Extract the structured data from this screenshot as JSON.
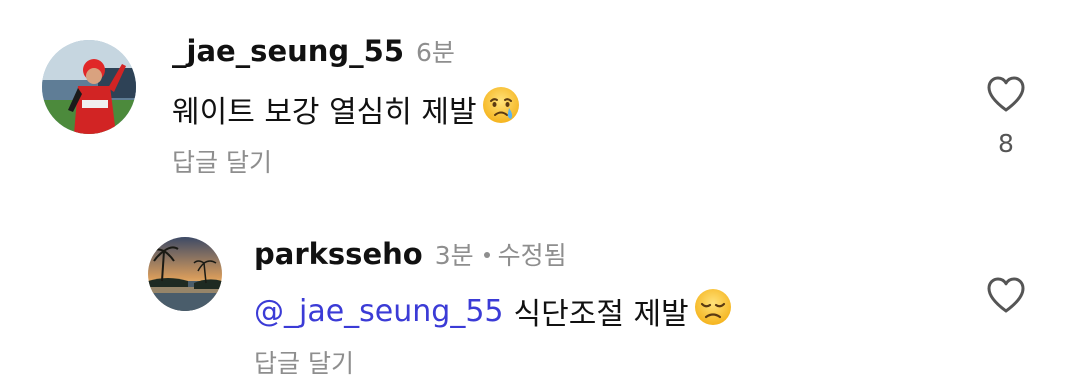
{
  "comments": [
    {
      "username": "_jae_seung_55",
      "time": "6분",
      "edited": "",
      "mention": "",
      "text": "웨이트 보강 열심히 제발",
      "emoji": "crying-face",
      "reply_label": "답글 달기",
      "like_count": "8",
      "avatar": "avatar-photo-baseball-player"
    },
    {
      "username": "parksseho",
      "time": "3분",
      "edited": "수정됨",
      "mention": "@_jae_seung_55",
      "text": "식단조절 제발",
      "emoji": "disappointed-face",
      "reply_label": "답글 달기",
      "like_count": "",
      "avatar": "avatar-photo-palm-sunset"
    }
  ],
  "colors": {
    "mention": "#3b3bd6",
    "meta": "#8e8e8e",
    "text": "#111111"
  }
}
